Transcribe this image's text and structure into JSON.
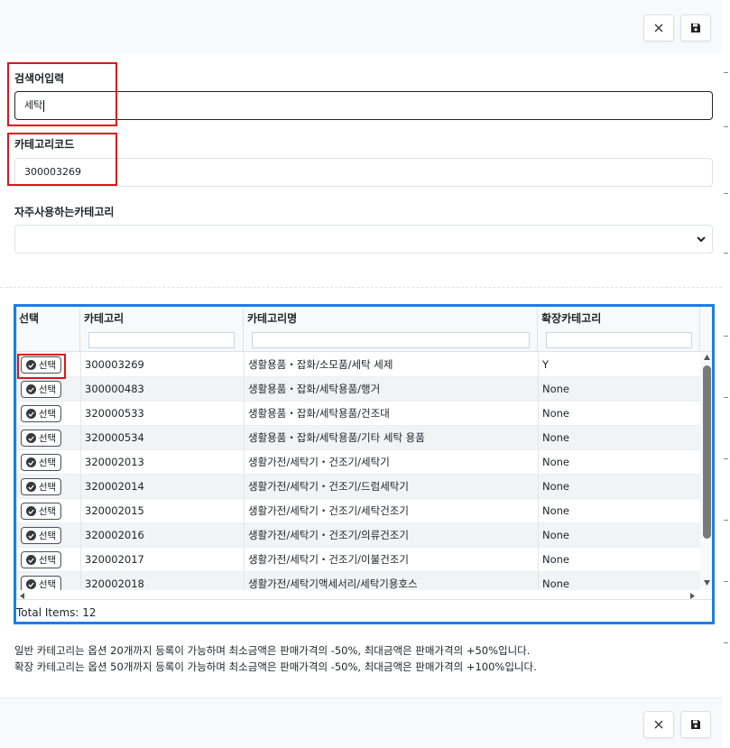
{
  "header": {
    "close_icon": "close-icon",
    "save_icon": "save-icon"
  },
  "form": {
    "search_label": "검색어입력",
    "search_value": "세탁",
    "category_code_label": "카테고리코드",
    "category_code_value": "300003269",
    "frequent_label": "자주사용하는카테고리",
    "frequent_value": ""
  },
  "grid": {
    "columns": [
      "선택",
      "카테고리",
      "카테고리명",
      "확장카테고리"
    ],
    "select_label": "선택",
    "rows": [
      {
        "code": "300003269",
        "name": "생활용품・잡화/소모품/세탁 세제",
        "ext": "Y"
      },
      {
        "code": "300000483",
        "name": "생활용품・잡화/세탁용품/행거",
        "ext": "None"
      },
      {
        "code": "320000533",
        "name": "생활용품・잡화/세탁용품/건조대",
        "ext": "None"
      },
      {
        "code": "320000534",
        "name": "생활용품・잡화/세탁용품/기타 세탁 용품",
        "ext": "None"
      },
      {
        "code": "320002013",
        "name": "생활가전/세탁기・건조기/세탁기",
        "ext": "None"
      },
      {
        "code": "320002014",
        "name": "생활가전/세탁기・건조기/드럼세탁기",
        "ext": "None"
      },
      {
        "code": "320002015",
        "name": "생활가전/세탁기・건조기/세탁건조기",
        "ext": "None"
      },
      {
        "code": "320002016",
        "name": "생활가전/세탁기・건조기/의류건조기",
        "ext": "None"
      },
      {
        "code": "320002017",
        "name": "생활가전/세탁기・건조기/이불건조기",
        "ext": "None"
      },
      {
        "code": "320002018",
        "name": "생활가전/세탁기액세서리/세탁기용호스",
        "ext": "None"
      }
    ],
    "total_items": "Total Items: 12"
  },
  "notes": [
    "일반 카테고리는 옵션 20개까지 등록이 가능하며 최소금액은 판매가격의 -50%, 최대금액은 판매가격의 +50%입니다.",
    "확장 카테고리는 옵션 50개까지 등록이 가능하며 최소금액은 판매가격의 -50%, 최대금액은 판매가격의 +100%입니다."
  ],
  "colors": {
    "highlight_red": "#e3121b",
    "highlight_blue": "#1a7fe6"
  }
}
